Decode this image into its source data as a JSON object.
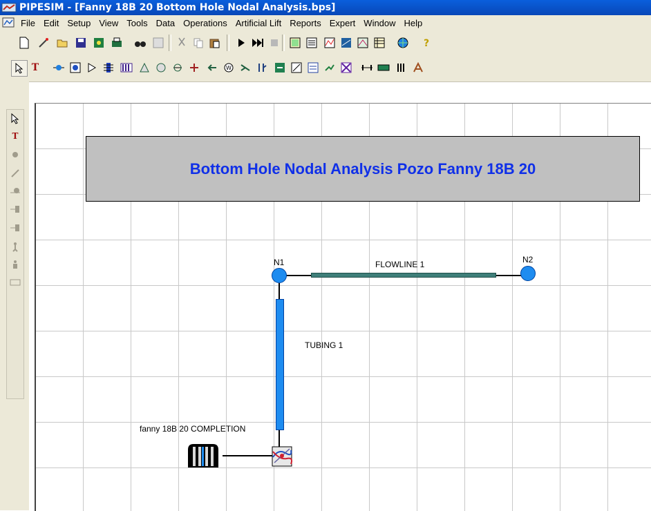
{
  "window": {
    "title": "PIPESIM - [Fanny 18B 20 Bottom Hole Nodal Analysis.bps]"
  },
  "menu": [
    "File",
    "Edit",
    "Setup",
    "View",
    "Tools",
    "Data",
    "Operations",
    "Artificial Lift",
    "Reports",
    "Expert",
    "Window",
    "Help"
  ],
  "canvas": {
    "banner_text": "Bottom Hole Nodal Analysis Pozo Fanny 18B 20",
    "node1_label": "N1",
    "node2_label": "N2",
    "flowline_label": "FLOWLINE 1",
    "tubing_label": "TUBING 1",
    "completion_label": "fanny 18B 20 COMPLETION"
  },
  "colors": {
    "banner_text": "#1030e8",
    "banner_bg": "#c0c0c0",
    "node": "#1e8cf0",
    "flowline": "#3f7f7a",
    "tubing": "#1e8cf0",
    "titlebar": "#0a5fdc"
  }
}
